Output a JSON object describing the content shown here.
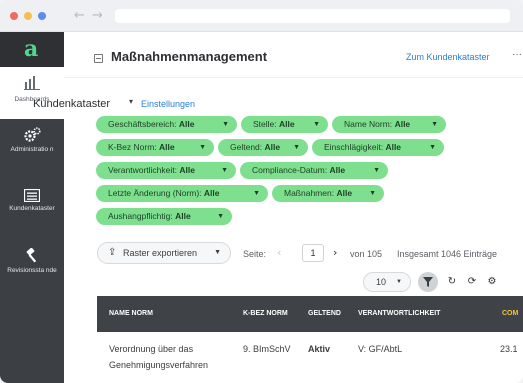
{
  "window": {
    "controls": {
      "close_color": "#f26b5e",
      "minimize_color": "#f6be4f",
      "zoom_color": "#5b8cf0"
    },
    "nav_back": "←",
    "nav_forward": "→"
  },
  "sidebar": {
    "logo": "a",
    "items": [
      {
        "label": "Dashboards",
        "icon": "bar-chart-icon",
        "active": true
      },
      {
        "label": "Administratio n",
        "icon": "gears-icon",
        "active": false
      },
      {
        "label": "Kundenkataster",
        "icon": "list-icon",
        "active": false
      },
      {
        "label": "Revisionssta nde",
        "icon": "gavel-icon",
        "active": false
      }
    ]
  },
  "header": {
    "title": "Maßnahmenmanagement",
    "link": "Zum Kundenkataster",
    "more": "···"
  },
  "kataster": {
    "title": "Kundenkataster",
    "caret": "▾",
    "settings_link": "Einstellungen"
  },
  "filters": [
    {
      "name": "Geschäftsbereich:",
      "value": "Alle"
    },
    {
      "name": "Stelle:",
      "value": "Alle"
    },
    {
      "name": "Name Norm:",
      "value": "Alle"
    },
    {
      "name": "K-Bez Norm:",
      "value": "Alle"
    },
    {
      "name": "Geltend:",
      "value": "Alle"
    },
    {
      "name": "Einschlägigkeit:",
      "value": "Alle"
    },
    {
      "name": "Verantwortlichkeit:",
      "value": "Alle"
    },
    {
      "name": "Compliance-Datum:",
      "value": "Alle"
    },
    {
      "name": "Letzte Änderung (Norm):",
      "value": "Alle"
    },
    {
      "name": "Maßnahmen:",
      "value": "Alle"
    },
    {
      "name": "Aushangpflichtig:",
      "value": "Alle"
    }
  ],
  "toolbar": {
    "export_label": "Raster exportieren",
    "page_label": "Seite:",
    "page_value": "1",
    "of_label": "von 105",
    "total_label": "Insgesamt 1046 Einträge",
    "page_size": "10"
  },
  "table": {
    "columns": [
      "NAME NORM",
      "K-BEZ NORM",
      "GELTEND",
      "VERANTWORTLICHKEIT",
      "COM"
    ],
    "rows": [
      {
        "name_line1": "Verordnung über das",
        "name_line2": "Genehmigungsverfahren",
        "kbez": "9. BImSchV",
        "geltend": "Aktiv",
        "verantwortlichkeit": "V: GF/AbtL",
        "compliance": "23.1"
      }
    ]
  },
  "colors": {
    "accent_green": "#7ee08f",
    "link_blue": "#2b7fd0",
    "sidebar_bg": "#3c3f44",
    "table_header_bg": "#3f4247",
    "com_header": "#f0c43a"
  }
}
